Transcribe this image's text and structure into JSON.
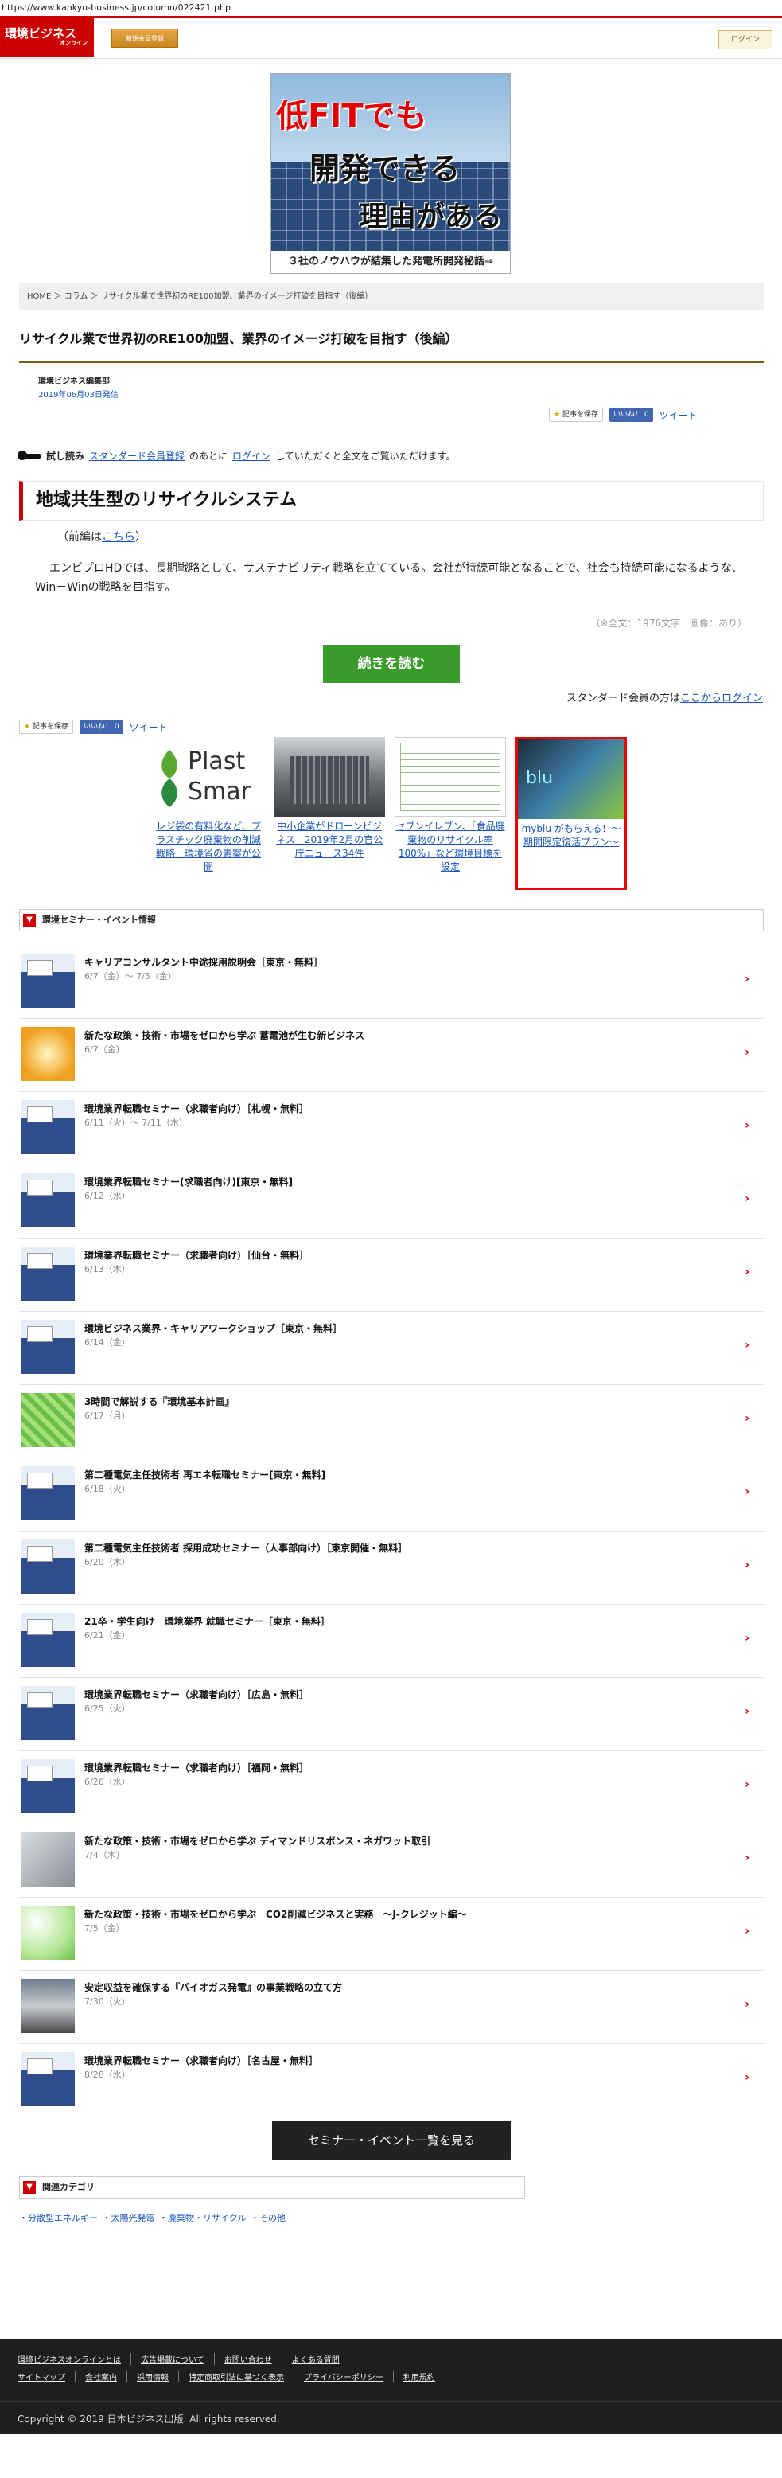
{
  "url": "https://www.kankyo-business.jp/column/022421.php",
  "header": {
    "logo_main": "環境ビジネス",
    "logo_sub": "オンライン",
    "register_label": "新規会員登録",
    "login_label": "ログイン"
  },
  "banner": {
    "line1": "低FITでも",
    "line2": "開発できる",
    "line3": "理由がある",
    "caption": "３社のノウハウが結集した発電所開発秘話⇒"
  },
  "breadcrumb": "HOME ＞ コラム ＞ リサイクル業で世界初のRE100加盟、業界のイメージ打破を目指す（後編）",
  "article": {
    "title": "リサイクル業で世界初のRE100加盟、業界のイメージ打破を目指す（後編）",
    "author": "環境ビジネス編集部",
    "date": "2019年06月03日発信",
    "save_label": "記事を保存",
    "like_label": "いいね！ 0",
    "tweet_label": "ツイート",
    "trial_label": "試し読み",
    "trial_link1": "スタンダード会員登録",
    "trial_mid": "のあとに",
    "trial_link2": "ログイン",
    "trial_end": "していただくと全文をご覧いただけます。",
    "section_title": "地域共生型のリサイクルシステム",
    "prev_text": "（前編は",
    "prev_link": "こちら",
    "prev_end": "）",
    "body": "エンビプロHDでは、長期戦略として、サステナビリティ戦略を立てている。会社が持続可能となることで、社会も持続可能になるような、Win－Winの戦略を目指す。",
    "char_count": "（※全文：1976文字　画像：あり）",
    "continue_label": "続きを読む",
    "member_text": "スタンダード会員の方は",
    "member_link": "ここからログイン"
  },
  "related_thumbs": [
    {
      "word": "Plast Smar",
      "caption": "レジ袋の有料化など、プラスチック廃棄物の削減戦略　環境省の素案が公開"
    },
    {
      "caption": "中小企業がドローンビジネス　2019年2月の官公庁ニュース34件"
    },
    {
      "caption": "セブンイレブン、「食品廃棄物のリサイクル率100%」など環境目標を設定"
    },
    {
      "word": "blu",
      "caption": "myblu がもらえる！～期間限定復活プラン～"
    }
  ],
  "events_section_title": "環境セミナー・イベント情報",
  "events": [
    {
      "title": "キャリアコンサルタント中途採用説明会［東京・無料］",
      "date": "6/7（金）～ 7/5（金）",
      "thumb": "seminar"
    },
    {
      "title": "新たな政策・技術・市場をゼロから学ぶ 蓄電池が生む新ビジネス",
      "date": "6/7（金）",
      "thumb": "battery"
    },
    {
      "title": "環境業界転職セミナー（求職者向け）［札幌・無料］",
      "date": "6/11（火）～ 7/11（木）",
      "thumb": "seminar"
    },
    {
      "title": "環境業界転職セミナー(求職者向け)[東京・無料]",
      "date": "6/12（水）",
      "thumb": "seminar"
    },
    {
      "title": "環境業界転職セミナー（求職者向け）［仙台・無料］",
      "date": "6/13（木）",
      "thumb": "seminar"
    },
    {
      "title": "環境ビジネス業界・キャリアワークショップ［東京・無料］",
      "date": "6/14（金）",
      "thumb": "seminar"
    },
    {
      "title": "3時間で解説する『環境基本計画』",
      "date": "6/17（月）",
      "thumb": "green"
    },
    {
      "title": "第二種電気主任技術者 再エネ転職セミナー[東京・無料]",
      "date": "6/18（火）",
      "thumb": "seminar"
    },
    {
      "title": "第二種電気主任技術者 採用成功セミナー（人事部向け）［東京開催・無料］",
      "date": "6/20（木）",
      "thumb": "seminar"
    },
    {
      "title": "21卒・学生向け　環境業界 就職セミナー［東京・無料］",
      "date": "6/21（金）",
      "thumb": "seminar"
    },
    {
      "title": "環境業界転職セミナー（求職者向け）［広島・無料］",
      "date": "6/25（火）",
      "thumb": "seminar"
    },
    {
      "title": "環境業界転職セミナー（求職者向け）［福岡・無料］",
      "date": "6/26（水）",
      "thumb": "seminar"
    },
    {
      "title": "新たな政策・技術・市場をゼロから学ぶ ディマンドリスポンス・ネガワット取引",
      "date": "7/4（木）",
      "thumb": "gray"
    },
    {
      "title": "新たな政策・技術・市場をゼロから学ぶ　CO2削減ビジネスと実務　～J-クレジット編～",
      "date": "7/5（金）",
      "thumb": "light"
    },
    {
      "title": "安定収益を確保する『バイオガス発電』の事業戦略の立て方",
      "date": "7/30（火）",
      "thumb": "plant"
    },
    {
      "title": "環境業界転職セミナー（求職者向け）［名古屋・無料］",
      "date": "8/28（水）",
      "thumb": "seminar"
    }
  ],
  "events_all_label": "セミナー・イベント一覧を見る",
  "related_section_title": "関連カテゴリ",
  "related_categories": [
    "分散型エネルギー",
    "太陽光発電",
    "廃棄物・リサイクル",
    "その他"
  ],
  "footer": {
    "row1": [
      "環境ビジネスオンラインとは",
      "広告掲載について",
      "お問い合わせ",
      "よくある質問"
    ],
    "row2": [
      "サイトマップ",
      "会社案内",
      "採用情報",
      "特定商取引法に基づく表示",
      "プライバシーポリシー",
      "利用規約"
    ],
    "copyright": "Copyright © 2019 日本ビジネス出版. All rights reserved."
  }
}
